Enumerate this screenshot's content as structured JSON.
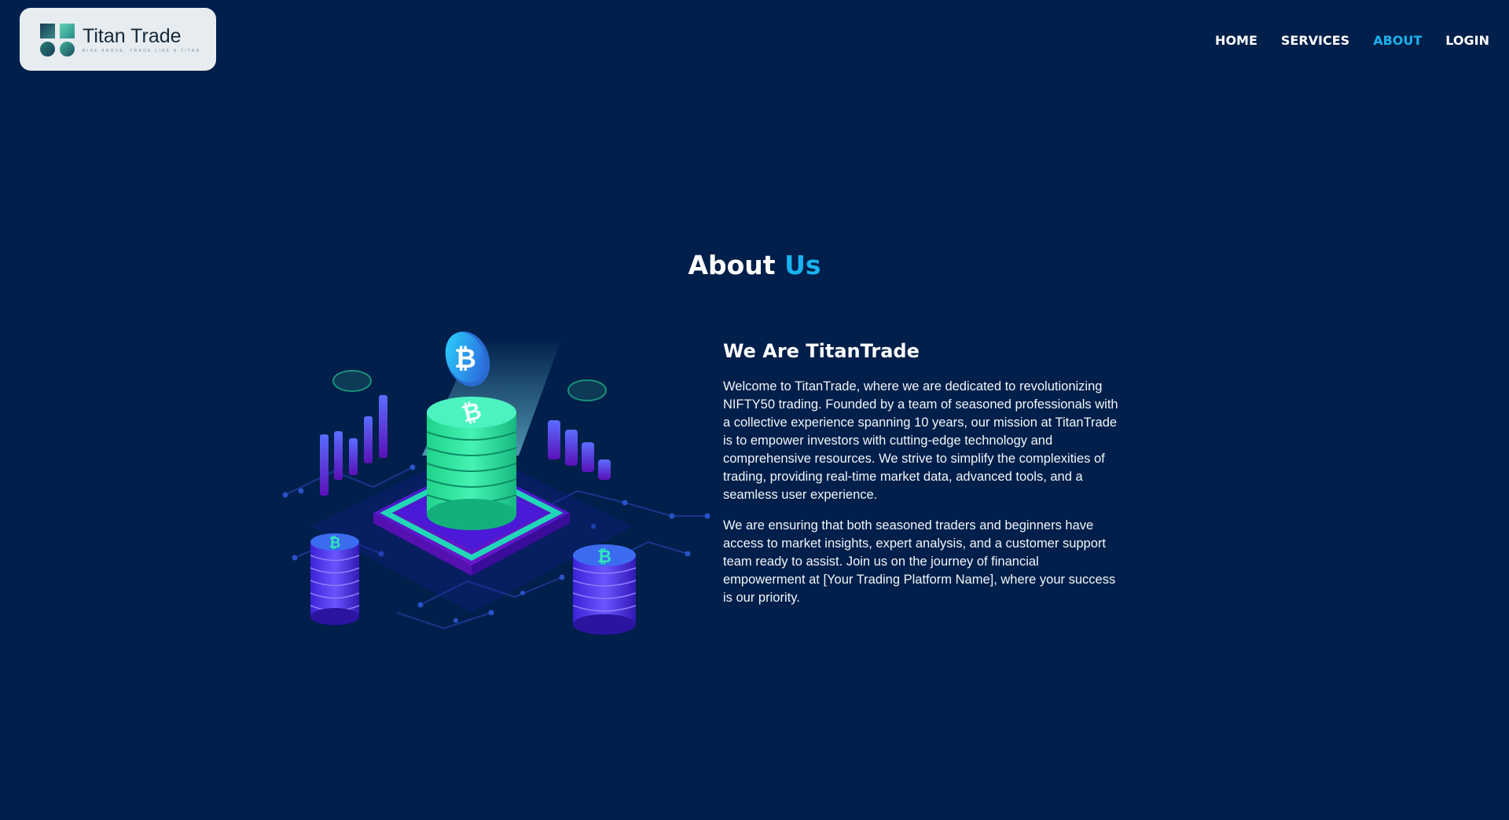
{
  "brand": {
    "name": "Titan Trade",
    "tagline": "RISE ABOVE, TRADE LIKE A TITAN"
  },
  "nav": {
    "items": [
      {
        "label": "HOME"
      },
      {
        "label": "SERVICES"
      },
      {
        "label": "ABOUT"
      },
      {
        "label": "LOGIN"
      }
    ],
    "active": "ABOUT"
  },
  "about": {
    "title_main": "About",
    "title_accent": "Us",
    "heading": "We Are TitanTrade",
    "paragraphs": [
      "Welcome to TitanTrade, where we are dedicated to revolutionizing NIFTY50 trading. Founded by a team of seasoned professionals with a collective experience spanning 10 years, our mission at TitanTrade is to empower investors with cutting-edge technology and comprehensive resources. We strive to simplify the complexities of trading, providing real-time market data, advanced tools, and a seamless user experience.",
      "We are ensuring that both seasoned traders and beginners have access to market insights, expert analysis, and a customer support team ready to assist. Join us on the journey of financial empowerment at [Your Trading Platform Name], where your success is our priority."
    ]
  },
  "colors": {
    "background": "#001f4a",
    "accent": "#19b2ee",
    "logo_card": "#e6ecf0"
  }
}
